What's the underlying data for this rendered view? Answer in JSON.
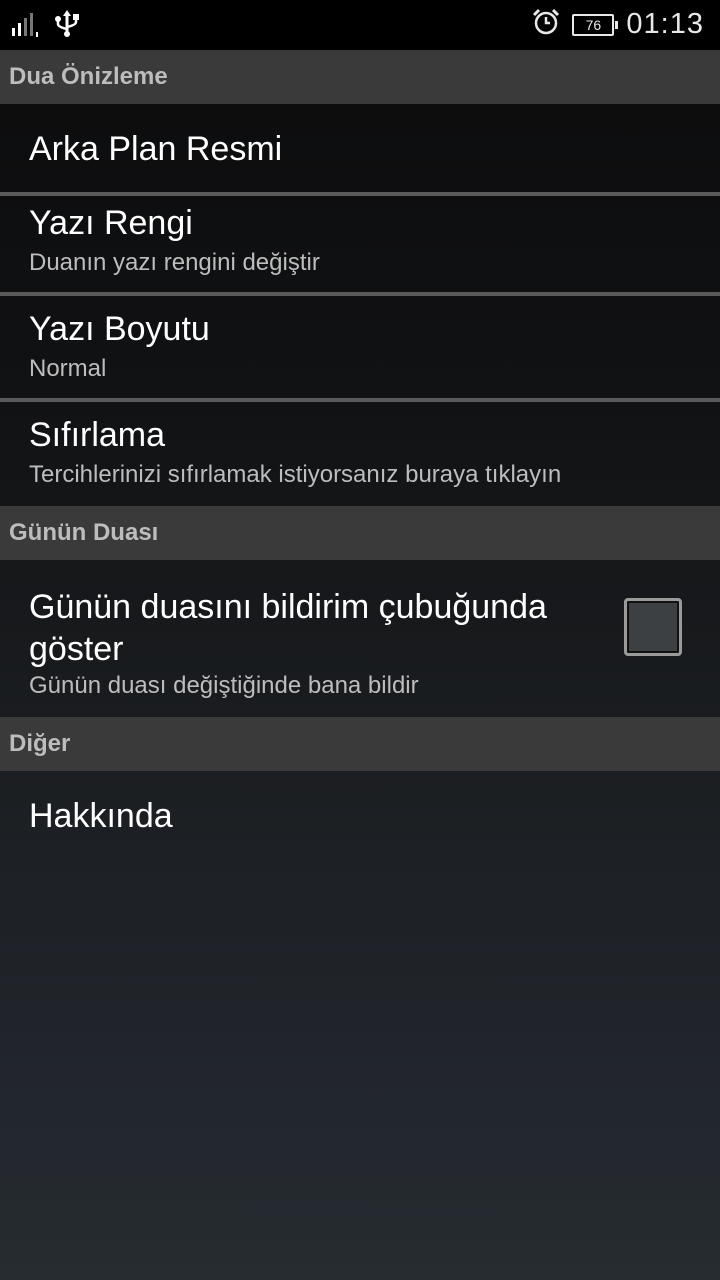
{
  "status_bar": {
    "signal_icon": "signal-bars-icon",
    "sim_label": "1",
    "usb_icon": "usb-icon",
    "alarm_icon": "alarm-clock-icon",
    "battery_level": "76",
    "time": "01:13"
  },
  "sections": [
    {
      "header": "Dua Önizleme",
      "items": [
        {
          "title": "Arka Plan Resmi",
          "summary": ""
        },
        {
          "title": "Yazı Rengi",
          "summary": "Duanın yazı rengini değiştir"
        },
        {
          "title": "Yazı Boyutu",
          "summary": "Normal"
        },
        {
          "title": "Sıfırlama",
          "summary": "Tercihlerinizi sıfırlamak istiyorsanız buraya tıklayın"
        }
      ]
    },
    {
      "header": "Günün Duası",
      "items": [
        {
          "title": "Günün duasını bildirim çubuğunda göster",
          "summary": "Günün duası değiştiğinde bana bildir",
          "checked": false
        }
      ]
    },
    {
      "header": "Diğer",
      "items": [
        {
          "title": "Hakkında",
          "summary": ""
        }
      ]
    }
  ]
}
